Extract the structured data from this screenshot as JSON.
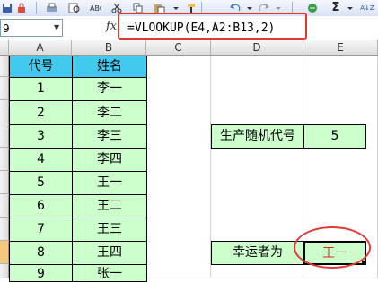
{
  "toolbar": {
    "icons": [
      "save-icon",
      "permission-icon",
      "print-icon",
      "print-preview-icon",
      "spelling-icon",
      "cut-icon",
      "copy-icon",
      "paste-icon",
      "format-painter-icon",
      "undo-icon",
      "redo-icon",
      "hyperlink-icon",
      "autosum-icon",
      "sort-ascending-icon"
    ],
    "autosum_glyph": "Σ",
    "sort_glyph": "A↓Z"
  },
  "formula_bar": {
    "name_box": "9",
    "fx_label": "fx",
    "formula": "=VLOOKUP(E4,A2:B13,2)"
  },
  "columns": [
    "A",
    "B",
    "C",
    "D",
    "E"
  ],
  "sheet": {
    "header_row": {
      "code": "代号",
      "name": "姓名"
    },
    "rows": [
      {
        "code": "1",
        "name": "李一"
      },
      {
        "code": "2",
        "name": "李二"
      },
      {
        "code": "3",
        "name": "李三"
      },
      {
        "code": "4",
        "name": "李四"
      },
      {
        "code": "5",
        "name": "王一"
      },
      {
        "code": "6",
        "name": "王二"
      },
      {
        "code": "7",
        "name": "王三"
      },
      {
        "code": "8",
        "name": "王四"
      },
      {
        "code": "9",
        "name": "张一"
      }
    ],
    "random_label": "生产随机代号",
    "random_value": "5",
    "winner_label": "幸运者为",
    "winner_value": "王一"
  },
  "colors": {
    "header_fill": "#41c9ee",
    "data_fill": "#ccffcc",
    "highlight_ring": "#e03a35",
    "winner_text": "#e0271f"
  }
}
